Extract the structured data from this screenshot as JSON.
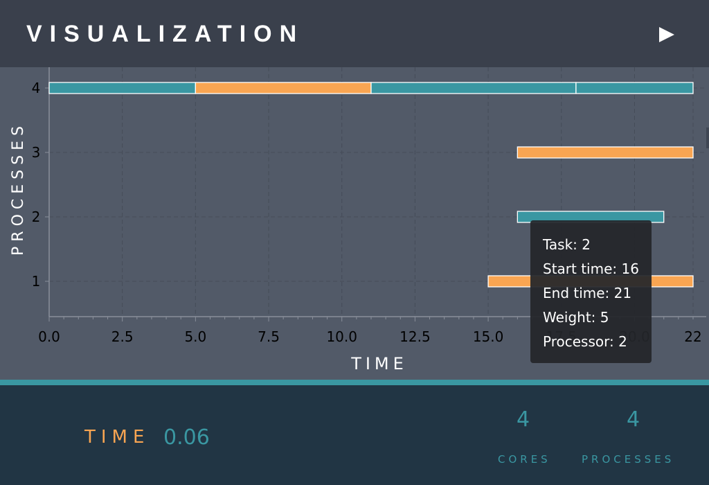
{
  "header": {
    "title": "VISUALIZATION",
    "play_icon": "play-icon"
  },
  "chart_data": {
    "type": "gantt",
    "xlabel": "TIME",
    "ylabel": "PROCESSES",
    "xlim": [
      0,
      22
    ],
    "x_ticks": [
      "0.0",
      "2.5",
      "5.0",
      "7.5",
      "10.0",
      "12.5",
      "15.0",
      "17.5",
      "20.0",
      "22"
    ],
    "y_ticks": [
      "1",
      "2",
      "3",
      "4"
    ],
    "grid": true,
    "colors": {
      "teal": "#3a97a2",
      "orange": "#f9a552"
    },
    "bars": [
      {
        "processor": 4,
        "start": 0,
        "end": 5,
        "color": "teal"
      },
      {
        "processor": 4,
        "start": 5,
        "end": 11,
        "color": "orange"
      },
      {
        "processor": 4,
        "start": 11,
        "end": 18,
        "color": "teal"
      },
      {
        "processor": 4,
        "start": 18,
        "end": 22,
        "color": "teal"
      },
      {
        "processor": 3,
        "start": 16,
        "end": 22,
        "color": "orange"
      },
      {
        "processor": 2,
        "start": 16,
        "end": 21,
        "color": "teal"
      },
      {
        "processor": 1,
        "start": 15,
        "end": 22,
        "color": "orange"
      }
    ]
  },
  "tooltip": {
    "lines": [
      "Task: 2",
      "Start time: 16",
      "End time: 21",
      "Weight: 5",
      "Processor: 2"
    ]
  },
  "footer": {
    "time_label": "TIME",
    "time_value": "0.06",
    "cores_value": "4",
    "cores_label": "CORES",
    "processes_value": "4",
    "processes_label": "PROCESSES"
  }
}
